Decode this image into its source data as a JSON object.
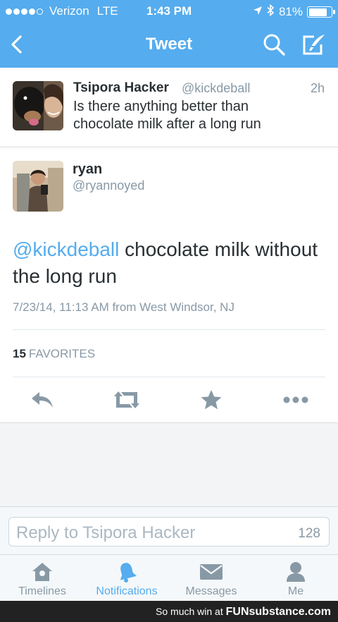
{
  "status_bar": {
    "carrier": "Verizon",
    "network": "LTE",
    "time": "1:43 PM",
    "battery": "81%",
    "battery_level": 0.81
  },
  "nav": {
    "title": "Tweet",
    "back_icon": "chevron-left-icon",
    "search_icon": "search-icon",
    "compose_icon": "compose-icon"
  },
  "parent_tweet": {
    "name": "Tsipora Hacker",
    "handle": "@kickdeball",
    "time": "2h",
    "text": "Is there anything better than chocolate milk after a long run"
  },
  "main_tweet": {
    "name": "ryan",
    "handle": "@ryannoyed",
    "mention": "@kickdeball",
    "text": " chocolate milk without the long run",
    "meta": "7/23/14, 11:13 AM from West Windsor, NJ",
    "favorites_count": "15",
    "favorites_label": "FAVORITES",
    "actions": [
      "reply-icon",
      "retweet-icon",
      "favorite-icon",
      "more-icon"
    ]
  },
  "reply": {
    "placeholder": "Reply to Tsipora Hacker",
    "char_count": "128"
  },
  "tab_bar": {
    "tabs": [
      {
        "label": "Timelines",
        "icon": "home-icon"
      },
      {
        "label": "Notifications",
        "icon": "bell-icon"
      },
      {
        "label": "Messages",
        "icon": "envelope-icon"
      },
      {
        "label": "Me",
        "icon": "person-icon"
      }
    ],
    "active": "Notifications"
  },
  "watermark": {
    "text": "So much win at",
    "logo": "FUNsubstance.com"
  },
  "colors": {
    "accent": "#55acee",
    "text": "#292f33",
    "muted": "#8899a6"
  }
}
